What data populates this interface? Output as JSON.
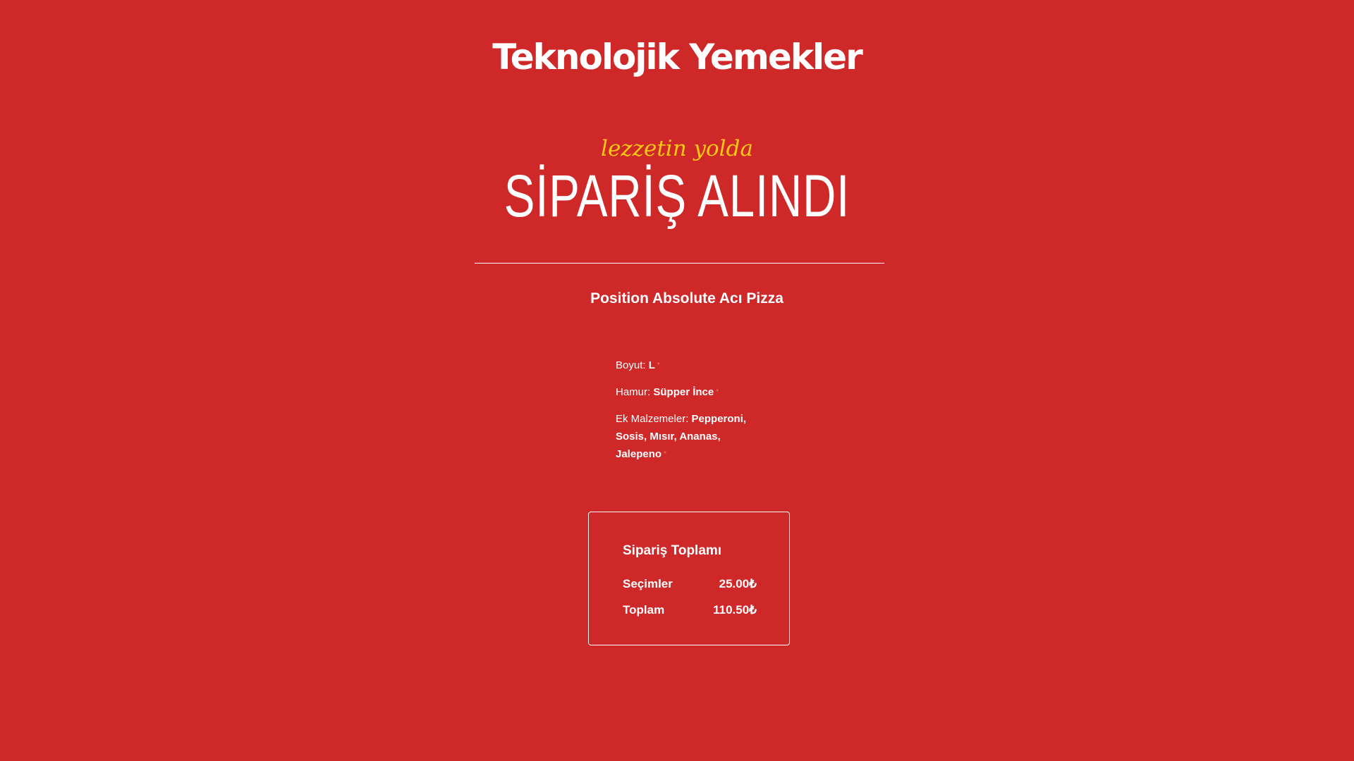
{
  "brand": {
    "name": "Teknolojik Yemekler"
  },
  "hero": {
    "tagline": "lezzetin yolda",
    "title": "SİPARİŞ ALINDI"
  },
  "order": {
    "product_name": "Position Absolute Acı Pizza",
    "options": [
      {
        "label": "Boyut:",
        "value": "L"
      },
      {
        "label": "Hamur:",
        "value": "Süpper İnce"
      },
      {
        "label": "Ek Malzemeler:",
        "value": "Pepperoni, Sosis, Mısır, Ananas, Jalepeno"
      }
    ]
  },
  "summary": {
    "title": "Sipariş Toplamı",
    "rows": [
      {
        "label": "Seçimler",
        "amount": "25.00₺"
      },
      {
        "label": "Toplam",
        "amount": "110.50₺"
      }
    ]
  },
  "colors": {
    "background": "#CE2829",
    "accent_yellow": "#FDC913",
    "text": "#FFFFFF"
  }
}
